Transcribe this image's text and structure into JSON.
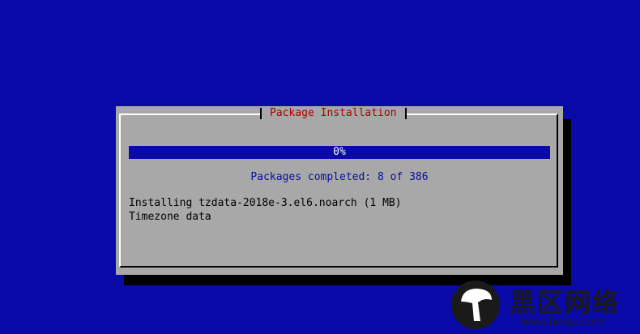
{
  "dialog": {
    "title": "Package Installation",
    "progress": {
      "percent": 0,
      "label": "0%"
    },
    "packages_completed": "Packages completed: 8 of 386",
    "current_package": "Installing tzdata-2018e-3.el6.noarch (1 MB)",
    "package_summary": "Timezone data"
  },
  "watermark": {
    "text": "黑区网络",
    "url": "www.heiqu.com"
  },
  "colors": {
    "background": "#0a0aa8",
    "dialog": "#a8a8a8",
    "title": "#a80000",
    "progress_bar": "#0a0aa8",
    "text_blue": "#0a0aa8"
  }
}
